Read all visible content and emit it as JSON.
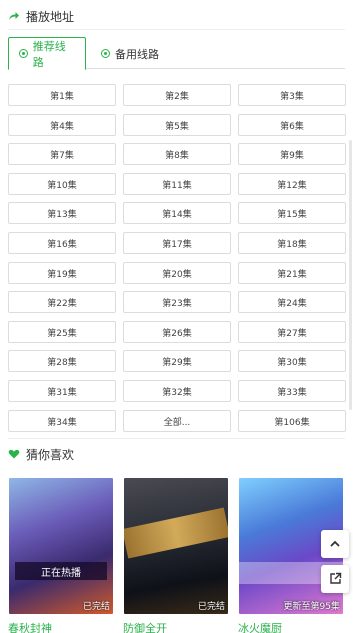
{
  "play_section": {
    "title": "播放地址",
    "tabs": [
      {
        "label": "推荐线路",
        "active": true
      },
      {
        "label": "备用线路",
        "active": false
      }
    ],
    "episodes": [
      "第1集",
      "第2集",
      "第3集",
      "第4集",
      "第5集",
      "第6集",
      "第7集",
      "第8集",
      "第9集",
      "第10集",
      "第11集",
      "第12集",
      "第13集",
      "第14集",
      "第15集",
      "第16集",
      "第17集",
      "第18集",
      "第19集",
      "第20集",
      "第21集",
      "第22集",
      "第23集",
      "第24集",
      "第25集",
      "第26集",
      "第27集",
      "第28集",
      "第29集",
      "第30集",
      "第31集",
      "第32集",
      "第33集",
      "第34集",
      "全部...",
      "第106集"
    ]
  },
  "recommend_section": {
    "title": "猜你喜欢",
    "items": [
      {
        "title": "春秋封神",
        "status": "已完结",
        "poster_text": "正在热播"
      },
      {
        "title": "防御全开",
        "status": "已完结"
      },
      {
        "title": "冰火魔厨",
        "status": "更新至第95集"
      }
    ]
  },
  "colors": {
    "accent": "#2bb24c",
    "border": "#dcdcdc"
  },
  "icons": {
    "play_section": "share-arrow-icon",
    "recommend_section": "heart-icon",
    "fab_top": "chevron-up-icon",
    "fab_share": "share-icon"
  }
}
